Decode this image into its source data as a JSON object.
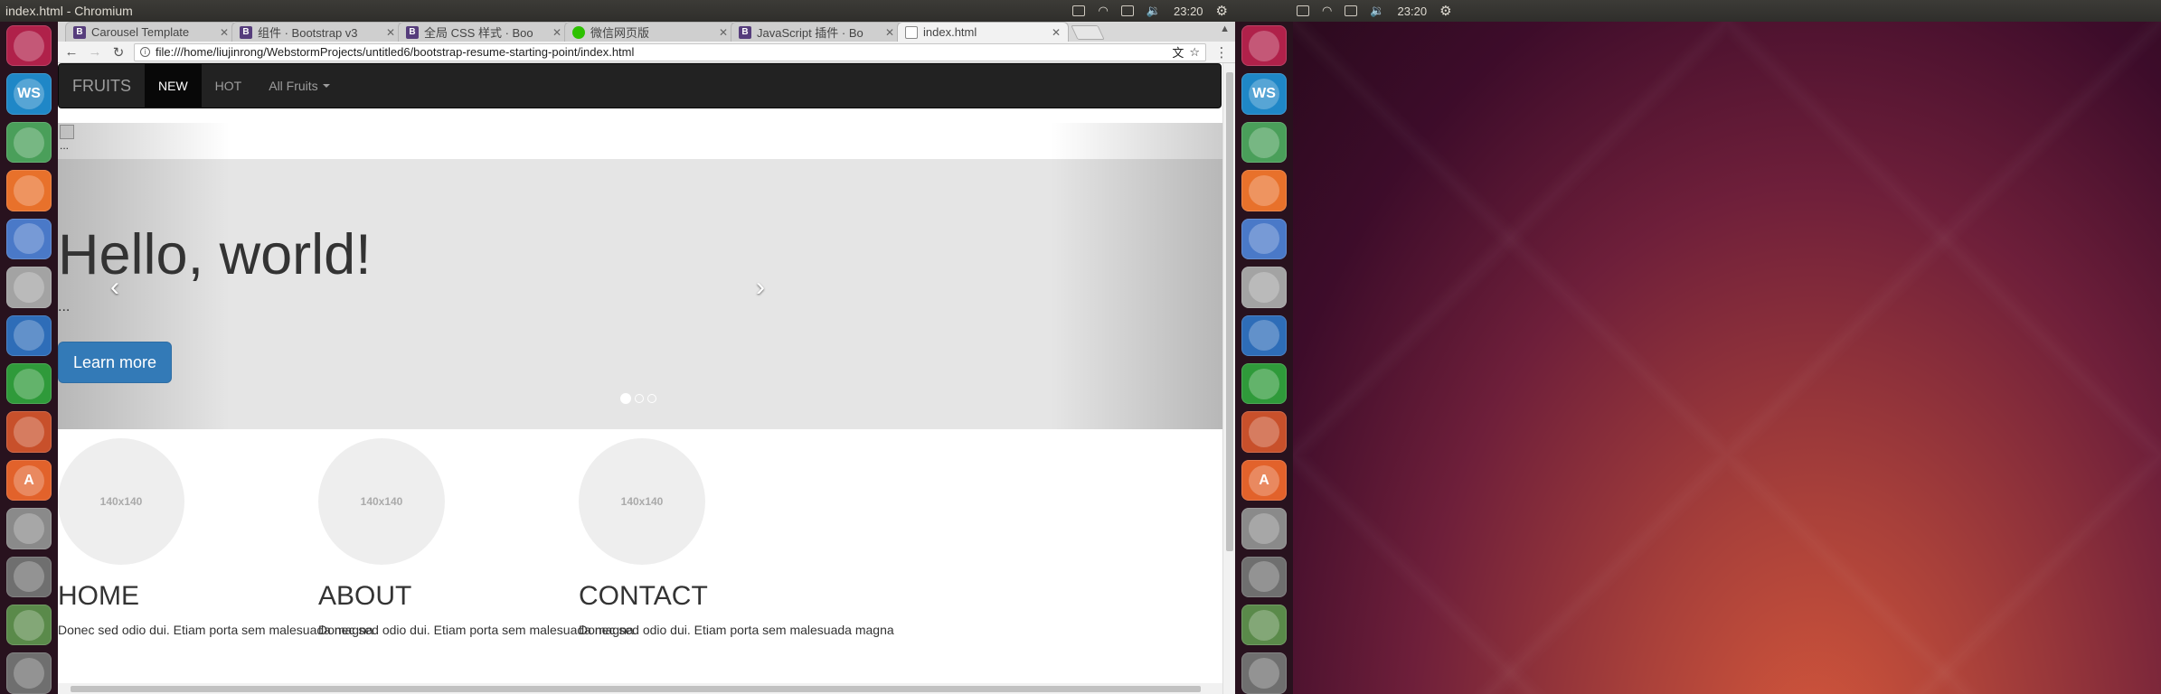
{
  "window": {
    "title": "index.html - Chromium"
  },
  "tray": {
    "time": "23:20",
    "gear": "⚙"
  },
  "launcher": {
    "icons": [
      {
        "name": "ubuntu-icon",
        "label": "",
        "bg": "#b0214a"
      },
      {
        "name": "webstorm-icon",
        "label": "WS",
        "bg": "#1f87c7"
      },
      {
        "name": "atom-icon",
        "label": "",
        "bg": "#4a9f5a"
      },
      {
        "name": "firefox-icon",
        "label": "",
        "bg": "#e8712b"
      },
      {
        "name": "chromium-icon",
        "label": "",
        "bg": "#4a79c8"
      },
      {
        "name": "files-icon",
        "label": "",
        "bg": "#a3a3a3"
      },
      {
        "name": "writer-icon",
        "label": "",
        "bg": "#2e6db8"
      },
      {
        "name": "calc-icon",
        "label": "",
        "bg": "#2f9a3a"
      },
      {
        "name": "impress-icon",
        "label": "",
        "bg": "#c8502b"
      },
      {
        "name": "software-center-icon",
        "label": "A",
        "bg": "#e2622b"
      },
      {
        "name": "settings-icon",
        "label": "",
        "bg": "#8a8a8a"
      },
      {
        "name": "drive-icon",
        "label": "",
        "bg": "#6f6f6f"
      },
      {
        "name": "drive2-icon",
        "label": "",
        "bg": "#5a8a4a"
      },
      {
        "name": "drive3-icon",
        "label": "",
        "bg": "#6f6f6f"
      }
    ]
  },
  "tabs": [
    {
      "fav": "B",
      "favtype": "bs",
      "label": "Carousel Template"
    },
    {
      "fav": "B",
      "favtype": "bs",
      "label": "组件 · Bootstrap v3"
    },
    {
      "fav": "B",
      "favtype": "bs",
      "label": "全局 CSS 样式 · Boo"
    },
    {
      "fav": "",
      "favtype": "wx",
      "label": "微信网页版"
    },
    {
      "fav": "B",
      "favtype": "bs",
      "label": "JavaScript 插件 · Bo"
    },
    {
      "fav": "",
      "favtype": "doc",
      "label": "index.html"
    }
  ],
  "toolbar": {
    "url": "file:///home/liujinrong/WebstormProjects/untitled6/bootstrap-resume-starting-point/index.html",
    "back": "←",
    "forward": "→",
    "reload": "↻",
    "translate": "文",
    "star": "☆",
    "menu": "⋮"
  },
  "navbar": {
    "brand": "FRUITS",
    "items": [
      {
        "label": "NEW",
        "active": true
      },
      {
        "label": "HOT",
        "active": false
      },
      {
        "label": "All Fruits",
        "active": false
      }
    ]
  },
  "carousel": {
    "img_alt": "...",
    "heading": "Hello, world!",
    "text": "...",
    "button": "Learn more",
    "prev": "‹",
    "next": "›",
    "indicators": 3,
    "active_index": 0
  },
  "features": [
    {
      "img": "140x140",
      "title": "HOME",
      "text": "Donec sed odio dui. Etiam porta sem malesuada magna"
    },
    {
      "img": "140x140",
      "title": "ABOUT",
      "text": "Donec sed odio dui. Etiam porta sem malesuada magna"
    },
    {
      "img": "140x140",
      "title": "CONTACT",
      "text": "Donec sed odio dui. Etiam porta sem malesuada magna"
    }
  ]
}
